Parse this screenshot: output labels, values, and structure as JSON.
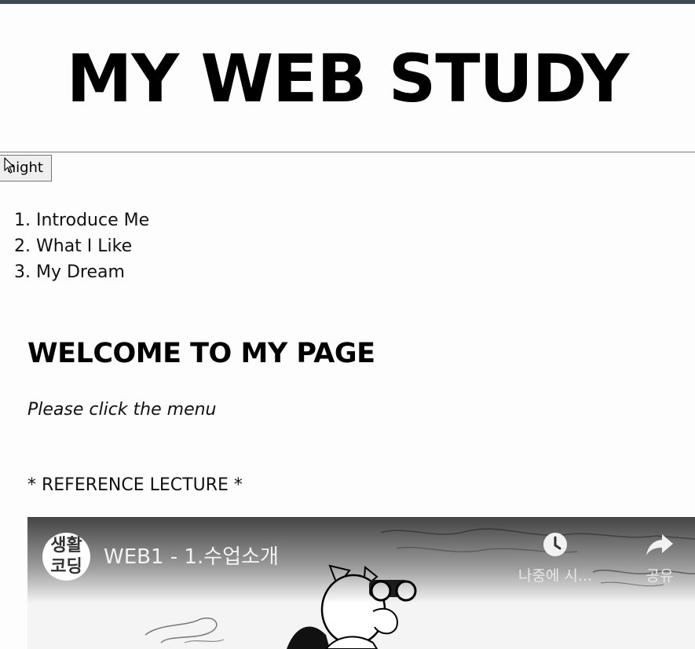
{
  "header": {
    "title": "MY WEB STUDY"
  },
  "controls": {
    "night_button_label": "night"
  },
  "menu": {
    "items": [
      {
        "number": "1.",
        "label": "Introduce Me"
      },
      {
        "number": "2.",
        "label": "What I Like"
      },
      {
        "number": "3.",
        "label": "My Dream"
      }
    ]
  },
  "main": {
    "heading": "WELCOME TO MY PAGE",
    "subtitle": "Please click the menu",
    "reference": "* REFERENCE LECTURE *"
  },
  "video": {
    "channel_avatar_text": [
      "생활",
      "코딩"
    ],
    "title": "WEB1 - 1.수업소개",
    "watch_later_label": "나중에 시...",
    "share_label": "공유",
    "watch_later_icon": "clock-icon",
    "share_icon": "share-arrow-icon"
  },
  "colors": {
    "topbar": "#3e4a53",
    "background": "#fdfdfd",
    "text": "#111111"
  }
}
